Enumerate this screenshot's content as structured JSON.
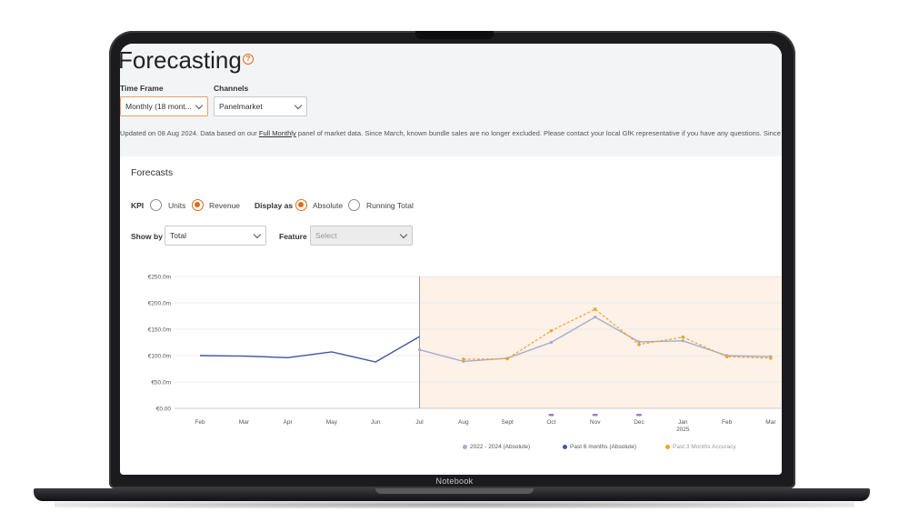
{
  "device": {
    "label": "Notebook"
  },
  "page": {
    "title": "Forecasting",
    "help_icon": "question-circle-icon"
  },
  "filters": {
    "time_frame_label": "Time Frame",
    "time_frame_value": "Monthly (18 mont...",
    "channels_label": "Channels",
    "channels_value": "Panelmarket"
  },
  "notice": {
    "prefix": "Updated on 08 Aug 2024. Data based on our ",
    "link": "Full Monthly",
    "suffix": " panel of market data. Since March, known bundle sales are no longer excluded. Please contact your local GfK representative if you have any questions. Since November"
  },
  "forecasts": {
    "title": "Forecasts",
    "kpi_label": "KPI",
    "kpi_options": [
      "Units",
      "Revenue"
    ],
    "kpi_selected": "Revenue",
    "display_label": "Display as",
    "display_options": [
      "Absolute",
      "Running Total"
    ],
    "display_selected": "Absolute",
    "show_by_label": "Show by",
    "show_by_value": "Total",
    "feature_label": "Feature",
    "feature_placeholder": "Select"
  },
  "colors": {
    "accent": "#e06a1b",
    "series_history": "#a6acd0",
    "series_past": "#3f57a3",
    "series_accuracy": "#f0a42a",
    "forecast_band": "#fdf1e8"
  },
  "chart_data": {
    "type": "line",
    "y_ticks": [
      "€0.00",
      "€50.0m",
      "€100.0m",
      "€150.0m",
      "€200.0m",
      "€250.0m"
    ],
    "ylim": [
      0,
      250
    ],
    "x_ticks": [
      {
        "label": "Feb",
        "sub": ""
      },
      {
        "label": "Mar",
        "sub": ""
      },
      {
        "label": "Apr",
        "sub": ""
      },
      {
        "label": "May",
        "sub": ""
      },
      {
        "label": "Jun",
        "sub": ""
      },
      {
        "label": "Jul",
        "sub": ""
      },
      {
        "label": "Aug",
        "sub": ""
      },
      {
        "label": "Sept",
        "sub": ""
      },
      {
        "label": "Oct",
        "sub": ""
      },
      {
        "label": "Nov",
        "sub": ""
      },
      {
        "label": "Dec",
        "sub": ""
      },
      {
        "label": "Jan",
        "sub": "2025"
      },
      {
        "label": "Feb",
        "sub": ""
      },
      {
        "label": "Mar",
        "sub": ""
      }
    ],
    "forecast_start_index": 5,
    "marker_indices": [
      8,
      9,
      10
    ],
    "series": [
      {
        "name": "Past 6 months (Absolute)",
        "points": [
          [
            0,
            100
          ],
          [
            1,
            99
          ],
          [
            2,
            96
          ],
          [
            3,
            107
          ],
          [
            4,
            88
          ],
          [
            5,
            136
          ]
        ]
      },
      {
        "name": "2022 - 2024 (Absolute)",
        "points": [
          [
            5,
            111
          ],
          [
            6,
            89
          ],
          [
            7,
            95
          ],
          [
            8,
            125
          ],
          [
            9,
            173
          ],
          [
            10,
            126
          ],
          [
            11,
            128
          ],
          [
            12,
            100
          ],
          [
            13,
            98
          ]
        ]
      },
      {
        "name": "Past 3 Months Accuracy",
        "points": [
          [
            6,
            93
          ],
          [
            7,
            94
          ],
          [
            8,
            147
          ],
          [
            9,
            188
          ],
          [
            10,
            121
          ],
          [
            11,
            135
          ],
          [
            12,
            98
          ],
          [
            13,
            95
          ]
        ]
      }
    ],
    "legend": [
      {
        "name": "2022 - 2024 (Absolute)",
        "color": "#a6acd0"
      },
      {
        "name": "Past 6 months (Absolute)",
        "color": "#3f57a3"
      },
      {
        "name": "Past 3 Months Accuracy",
        "color": "#f0a42a"
      }
    ]
  }
}
